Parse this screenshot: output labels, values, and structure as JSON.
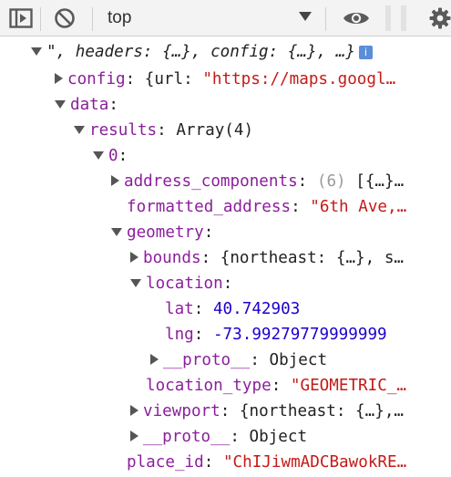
{
  "toolbar": {
    "context": "top",
    "icons": [
      "sidebar-icon",
      "clear-console-icon",
      "dropdown-caret-icon",
      "eye-icon",
      "gear-icon"
    ]
  },
  "tree": {
    "row0": {
      "text": "\", headers: {…}, config: {…}, …}",
      "badge": "i"
    },
    "row1": {
      "key": "config",
      "text": ": {url: ",
      "str": "\"https://maps.googl…"
    },
    "row2": {
      "key": "data",
      "text": ":"
    },
    "row3": {
      "key": "results",
      "text": ": Array(4)"
    },
    "row4": {
      "key": "0",
      "text": ":"
    },
    "row5": {
      "key": "address_components",
      "text": ": ",
      "dim": "(6)",
      "text2": " [{…}…"
    },
    "row6": {
      "key": "formatted_address",
      "text": ": ",
      "str": "\"6th Ave,…"
    },
    "row7": {
      "key": "geometry",
      "text": ":"
    },
    "row8": {
      "key": "bounds",
      "text": ": {northeast: {…}, s…"
    },
    "row9": {
      "key": "location",
      "text": ":"
    },
    "row10": {
      "key": "lat",
      "text": ": ",
      "num": "40.742903"
    },
    "row11": {
      "key": "lng",
      "text": ": ",
      "num": "-73.99279779999999"
    },
    "row12": {
      "key": "__proto__",
      "text": ": Object"
    },
    "row13": {
      "key": "location_type",
      "text": ": ",
      "str": "\"GEOMETRIC_…"
    },
    "row14": {
      "key": "viewport",
      "text": ": {northeast: {…},…"
    },
    "row15": {
      "key": "__proto__",
      "text": ": Object"
    },
    "row16": {
      "key": "place_id",
      "text": ": ",
      "str": "\"ChIJiwmADCBawokRE…"
    }
  },
  "colors": {
    "key": "#8b1f9c",
    "string": "#c41a16",
    "number": "#1c00cf",
    "toolbar_bg": "#f3f3f3"
  }
}
